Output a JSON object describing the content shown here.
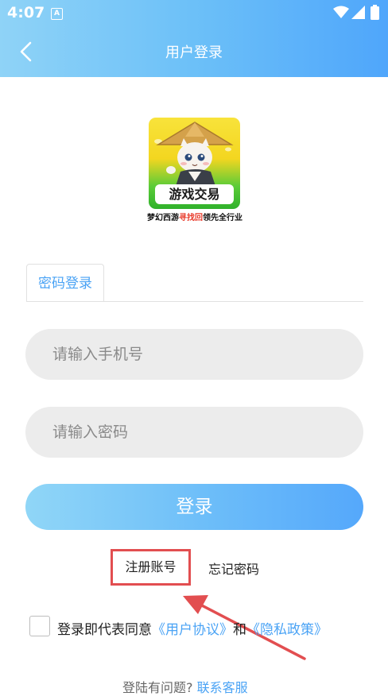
{
  "status_bar": {
    "time": "4:07",
    "notification_icon": "A"
  },
  "header": {
    "title": "用户登录",
    "back_icon": "chevron-left"
  },
  "logo": {
    "label": "游戏交易",
    "tagline_part1": "梦幻西游",
    "tagline_highlight": "寻找回",
    "tagline_part2": "领先全行业"
  },
  "tabs": [
    {
      "label": "密码登录",
      "active": true
    }
  ],
  "form": {
    "phone_placeholder": "请输入手机号",
    "password_placeholder": "请输入密码",
    "login_button": "登录"
  },
  "links": {
    "register": "注册账号",
    "forgot": "忘记密码"
  },
  "agreement": {
    "checked": false,
    "prefix": "登录即代表同意",
    "user_agreement": "《用户协议》",
    "and": "和",
    "privacy_policy": "《隐私政策》"
  },
  "help": {
    "question": "登陆有问题?",
    "contact": "联系客服"
  },
  "colors": {
    "accent": "#4aa3f5",
    "highlight": "#e24e50"
  }
}
